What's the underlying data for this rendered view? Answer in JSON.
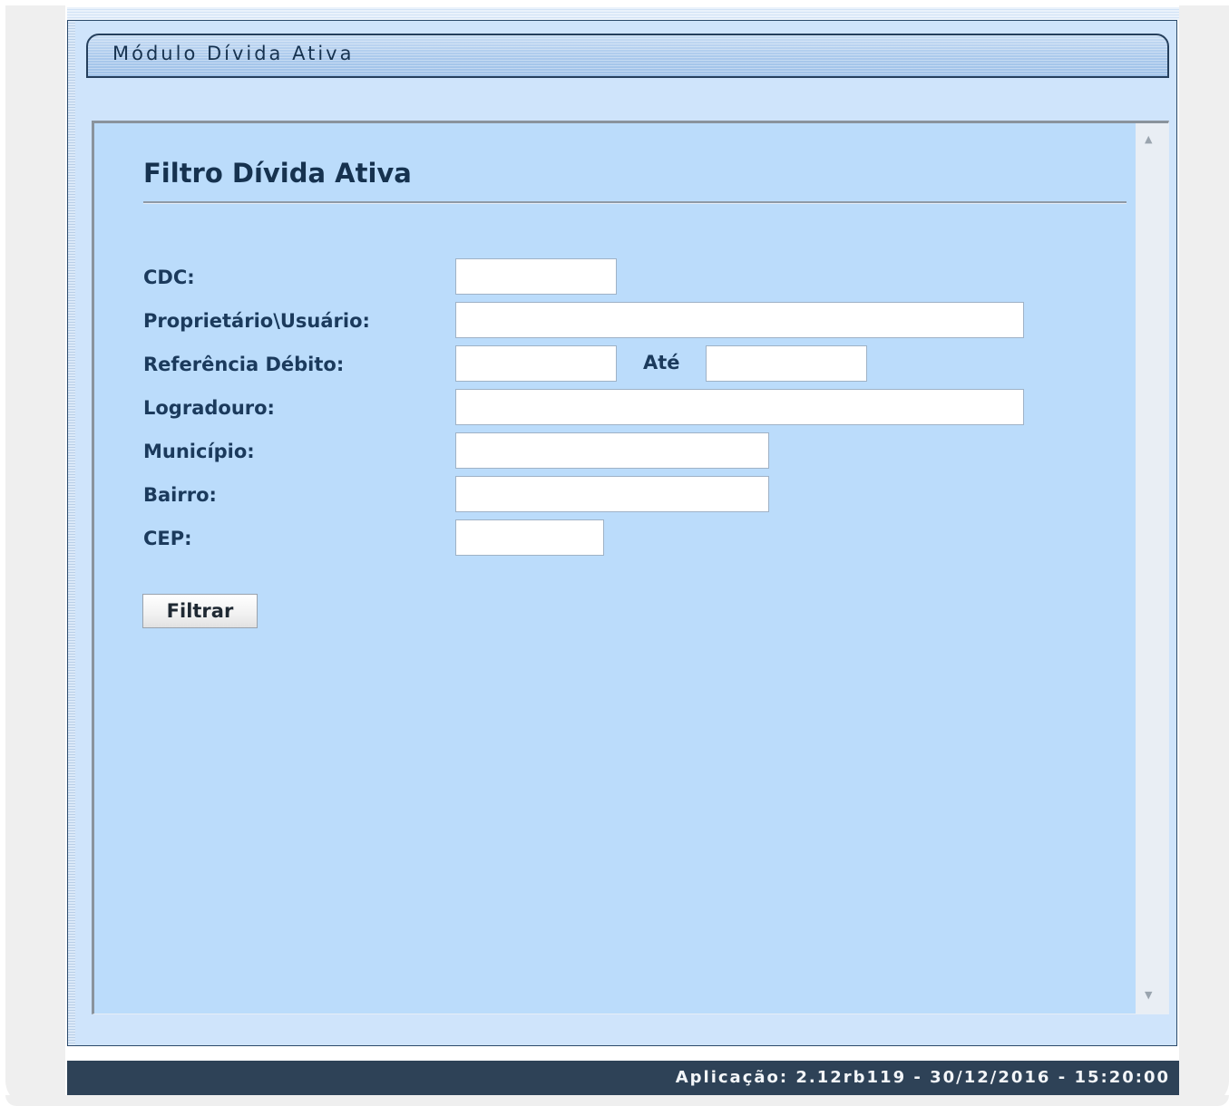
{
  "module": {
    "title": "Módulo Dívida Ativa"
  },
  "page": {
    "title": "Filtro Dívida Ativa"
  },
  "form": {
    "cdc_label": "CDC:",
    "cdc_value": "",
    "proprietario_label": "Proprietário\\Usuário:",
    "proprietario_value": "",
    "referencia_label": "Referência Débito:",
    "referencia_inicio_value": "",
    "ate_label": "Até",
    "referencia_fim_value": "",
    "logradouro_label": "Logradouro:",
    "logradouro_value": "",
    "municipio_label": "Município:",
    "municipio_value": "",
    "bairro_label": "Bairro:",
    "bairro_value": "",
    "cep_label": "CEP:",
    "cep_value": "",
    "filter_button_label": "Filtrar"
  },
  "footer": {
    "app_info": "Aplicação: 2.12rb119 - 30/12/2016 - 15:20:00"
  },
  "icons": {
    "scroll_up": "scroll-up-arrow-icon",
    "scroll_down": "scroll-down-arrow-icon"
  },
  "colors": {
    "panel_background": "#bbdcfb",
    "window_background": "#cfe4fb",
    "title_text": "#16324f",
    "footer_background": "#2e4257"
  }
}
